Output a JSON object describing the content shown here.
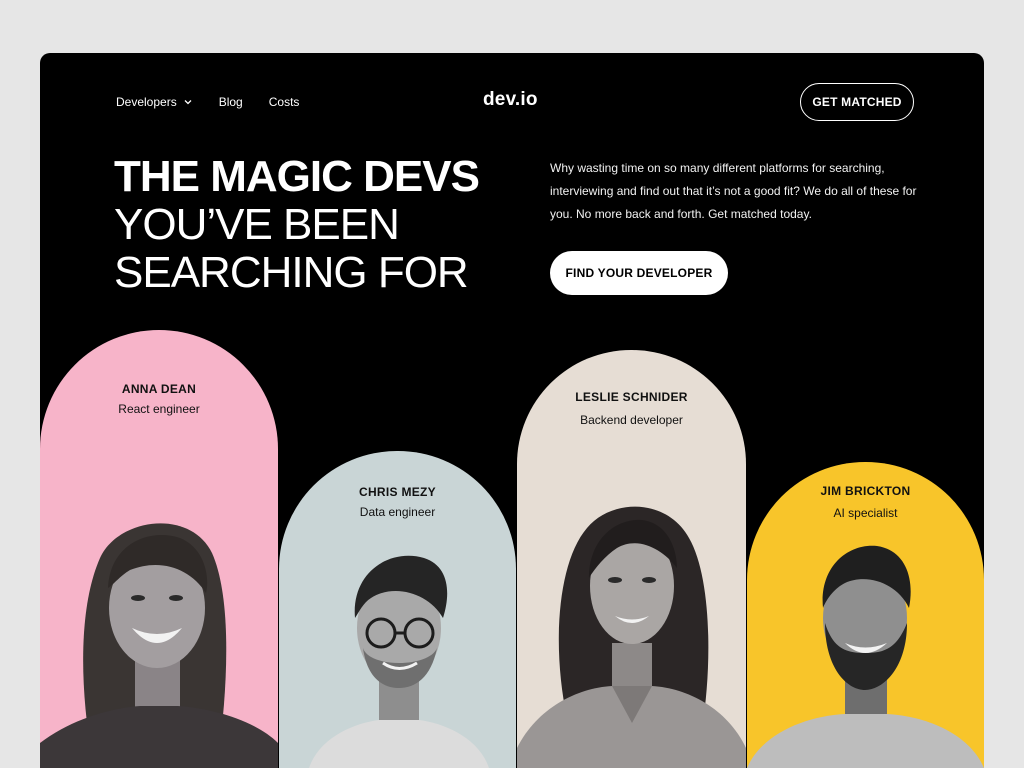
{
  "nav": {
    "items": [
      {
        "label": "Developers",
        "has_dropdown": true
      },
      {
        "label": "Blog"
      },
      {
        "label": "Costs"
      }
    ],
    "logo": "dev.io",
    "cta_label": "GET MATCHED"
  },
  "hero": {
    "title_line1": "THE MAGIC DEVS",
    "title_line2": "YOU’VE BEEN",
    "title_line3": "SEARCHING FOR",
    "description": "Why wasting time on so many different platforms for searching, interviewing and find out that it’s not a good fit? We do all of these for you. No more back and forth. Get matched today.",
    "button_label": "FIND YOUR DEVELOPER"
  },
  "developers": [
    {
      "name": "ANNA DEAN",
      "role": "React engineer",
      "color": "#f7b4c9"
    },
    {
      "name": "CHRIS MEZY",
      "role": "Data engineer",
      "color": "#c9d5d6"
    },
    {
      "name": "LESLIE SCHNIDER",
      "role": "Backend developer",
      "color": "#e6ddd4"
    },
    {
      "name": "JIM BRICKTON",
      "role": "AI specialist",
      "color": "#f8c52a"
    }
  ],
  "colors": {
    "page_bg": "#e6e6e6",
    "frame_bg": "#000000",
    "text_primary": "#ffffff"
  }
}
